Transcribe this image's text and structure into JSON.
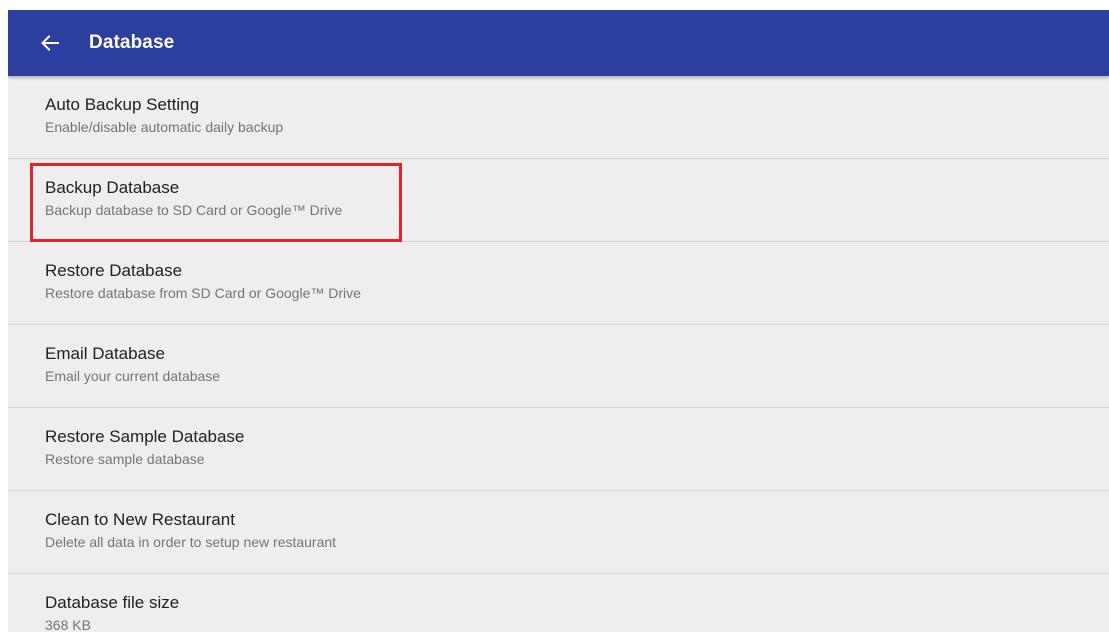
{
  "appbar": {
    "title": "Database",
    "back_icon": "arrow-back-icon",
    "color": "#2c3e9e"
  },
  "preferences": [
    {
      "title": "Auto Backup Setting",
      "summary": "Enable/disable automatic daily backup"
    },
    {
      "title": "Backup Database",
      "summary": "Backup database to SD Card or Google™ Drive",
      "highlighted": true
    },
    {
      "title": "Restore Database",
      "summary": "Restore database from SD Card or Google™ Drive"
    },
    {
      "title": "Email Database",
      "summary": "Email your current database"
    },
    {
      "title": "Restore Sample Database",
      "summary": "Restore sample database"
    },
    {
      "title": "Clean to New Restaurant",
      "summary": "Delete all data in order to setup new restaurant"
    },
    {
      "title": "Database file size",
      "summary": "368 KB"
    }
  ],
  "highlight_color": "#e32129"
}
